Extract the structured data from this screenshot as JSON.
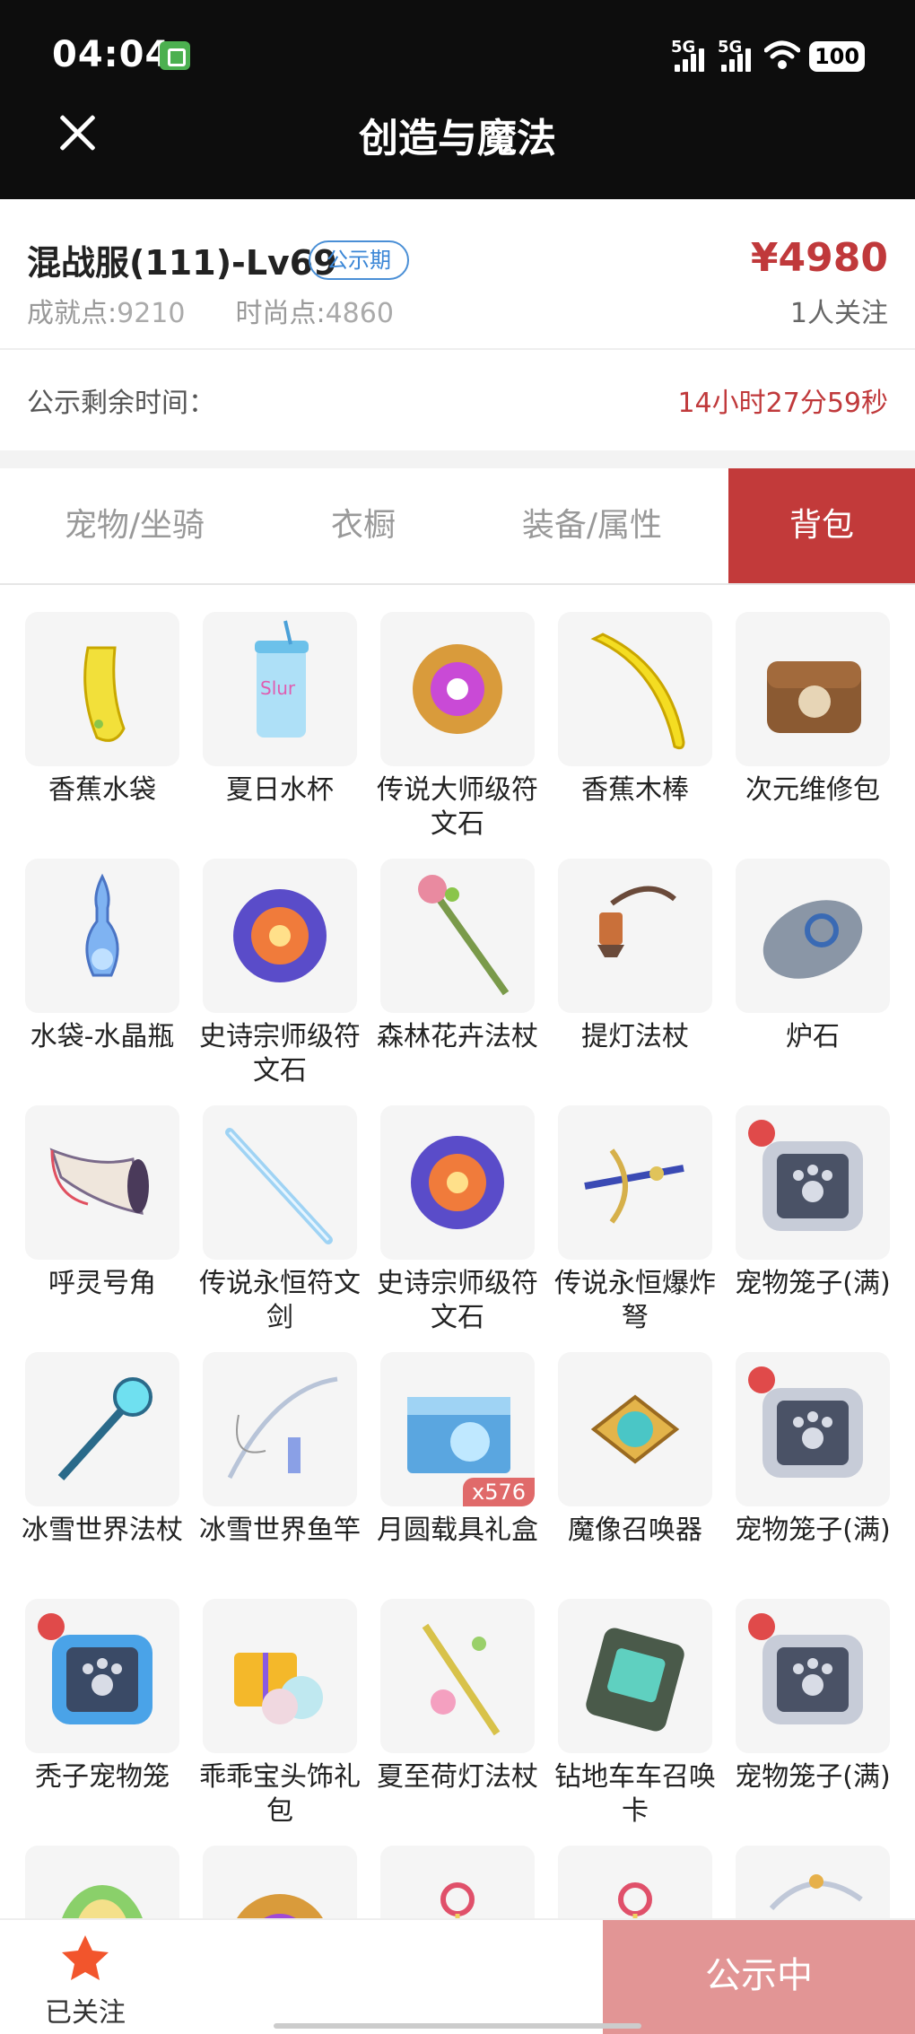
{
  "status_bar": {
    "time": "04:04",
    "signal1": "5G",
    "signal2": "5G",
    "battery": "100"
  },
  "nav": {
    "title": "创造与魔法"
  },
  "listing": {
    "title": "混战服(111)-Lv69",
    "badge": "公示期",
    "achievement_label": "成就点:",
    "achievement_value": "9210",
    "fashion_label": "时尚点:",
    "fashion_value": "4860",
    "price": "¥4980",
    "followers": "1人关注"
  },
  "countdown": {
    "label": "公示剩余时间：",
    "value": "14小时27分59秒"
  },
  "tabs": [
    {
      "label": "宠物/坐骑"
    },
    {
      "label": "衣橱"
    },
    {
      "label": "装备/属性"
    },
    {
      "label": "背包"
    }
  ],
  "items": [
    {
      "name": "香蕉水袋",
      "icon": "banana-waterbag-icon"
    },
    {
      "name": "夏日水杯",
      "icon": "summer-cup-icon"
    },
    {
      "name": "传说大师级符文石",
      "icon": "legend-rune-stone-icon"
    },
    {
      "name": "香蕉木棒",
      "icon": "banana-stick-icon"
    },
    {
      "name": "次元维修包",
      "icon": "repair-kit-icon"
    },
    {
      "name": "水袋-水晶瓶",
      "icon": "crystal-bottle-icon"
    },
    {
      "name": "史诗宗师级符文石",
      "icon": "epic-rune-stone-icon"
    },
    {
      "name": "森林花卉法杖",
      "icon": "flower-staff-icon"
    },
    {
      "name": "提灯法杖",
      "icon": "lantern-staff-icon"
    },
    {
      "name": "炉石",
      "icon": "hearthstone-icon"
    },
    {
      "name": "呼灵号角",
      "icon": "horn-icon"
    },
    {
      "name": "传说永恒符文剑",
      "icon": "rune-sword-icon"
    },
    {
      "name": "史诗宗师级符文石",
      "icon": "epic-rune-stone-icon"
    },
    {
      "name": "传说永恒爆炸弩",
      "icon": "crossbow-icon"
    },
    {
      "name": "宠物笼子(满)",
      "icon": "pet-cage-icon"
    },
    {
      "name": "冰雪世界法杖",
      "icon": "ice-staff-icon"
    },
    {
      "name": "冰雪世界鱼竿",
      "icon": "fishing-rod-icon"
    },
    {
      "name": "月圆载具礼盒",
      "icon": "gift-box-icon",
      "qty": "x576"
    },
    {
      "name": "魔像召唤器",
      "icon": "golem-summoner-icon"
    },
    {
      "name": "宠物笼子(满)",
      "icon": "pet-cage-icon"
    },
    {
      "name": "秃子宠物笼",
      "icon": "blue-pet-cage-icon"
    },
    {
      "name": "乖乖宝头饰礼包",
      "icon": "headwear-gift-icon"
    },
    {
      "name": "夏至荷灯法杖",
      "icon": "lotus-staff-icon"
    },
    {
      "name": "钻地车车召唤卡",
      "icon": "summon-card-icon"
    },
    {
      "name": "宠物笼子(满)",
      "icon": "pet-cage-icon"
    },
    {
      "name": "",
      "icon": "egg-icon"
    },
    {
      "name": "",
      "icon": "rune-stone-icon"
    },
    {
      "name": "",
      "icon": "lollipop-icon"
    },
    {
      "name": "",
      "icon": "lollipop-icon"
    },
    {
      "name": "",
      "icon": "bow-icon"
    }
  ],
  "bottom": {
    "follow_label": "已关注",
    "status_label": "公示中"
  },
  "colors": {
    "accent": "#c23a3a",
    "price": "#c0393b",
    "badge": "#3a86d6"
  }
}
